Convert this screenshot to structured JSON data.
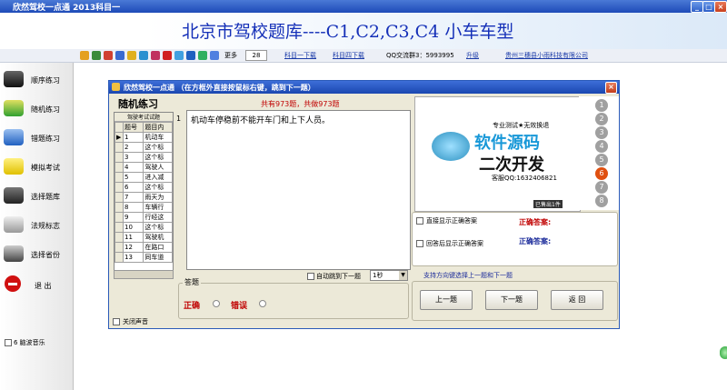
{
  "window": {
    "title": "欣然驾校一点通 2013科目一"
  },
  "banner": {
    "title": "北京市驾校题库----C1,C2,C3,C4 小车车型"
  },
  "toolbar": {
    "more_label": "更多",
    "count": "28",
    "links": [
      "科目一下载",
      "科目四下载"
    ],
    "qq_group": "QQ交流群3：5993995",
    "upgrade": "升级",
    "company": "贵州三穗县小雨科技有限公司"
  },
  "sidebar": {
    "items": [
      {
        "label": "顺序练习",
        "icon": "car-icon"
      },
      {
        "label": "随机练习",
        "icon": "car-icon"
      },
      {
        "label": "错题练习",
        "icon": "car-icon"
      },
      {
        "label": "模拟考试",
        "icon": "car-icon"
      },
      {
        "label": "选择题库",
        "icon": "car-icon"
      },
      {
        "label": "法规标志",
        "icon": "car-icon"
      },
      {
        "label": "选择省份",
        "icon": "car-icon"
      },
      {
        "label": "退  出",
        "icon": "exit-icon"
      }
    ],
    "music_label": "6 脑波音乐"
  },
  "dialog": {
    "title": "欣然驾校一点通 （在方框外直接按鼠标右键，跳到下一题）",
    "mode_title": "随机练习",
    "summary": "共有973题，共做973题",
    "grid": {
      "header_top": "驾驶考试试题",
      "headers": [
        "题号",
        "题目内"
      ],
      "rows": [
        [
          "1",
          "机动车"
        ],
        [
          "2",
          "这个标"
        ],
        [
          "3",
          "这个标"
        ],
        [
          "4",
          "驾驶人"
        ],
        [
          "5",
          "进入减"
        ],
        [
          "6",
          "这个标"
        ],
        [
          "7",
          "雨天为"
        ],
        [
          "8",
          "车辆行"
        ],
        [
          "9",
          "行经这"
        ],
        [
          "10",
          "这个标"
        ],
        [
          "11",
          "驾驶机"
        ],
        [
          "12",
          "在路口"
        ],
        [
          "13",
          "同车道"
        ]
      ]
    },
    "question_no": "1",
    "question_text": "机动车停稳前不能开车门和上下人员。",
    "ad": {
      "line1": "专业测试★无效换退",
      "big1": "软件源码",
      "big2": "二次开发",
      "contact": "客服QQ:1632406821",
      "sold": "已售出1件"
    },
    "side_numbers": [
      "1",
      "2",
      "3",
      "4",
      "5",
      "6",
      "7",
      "8"
    ],
    "active_number": "6",
    "auto_next_label": "自动跳到下一题",
    "delay_value": "1秒",
    "answer_group_label": "答题",
    "answer_correct": "正确",
    "answer_wrong": "错误",
    "show_answer_label": "直接显示正确答案",
    "after_answer_label": "回答后显示正确答案",
    "correct_answer_label": "正确答案:",
    "correct_answer_label2": "正确答案:",
    "hint": "支持方向键选择上一题和下一题",
    "prev_button": "上一题",
    "next_button": "下一题",
    "back_button": "返  回",
    "mute_label": "关闭声音"
  },
  "colors": {
    "title_blue": "#1a47b0",
    "banner_text": "#1530b8",
    "accent_red": "#c00000",
    "link_blue": "#1a3aa8"
  }
}
